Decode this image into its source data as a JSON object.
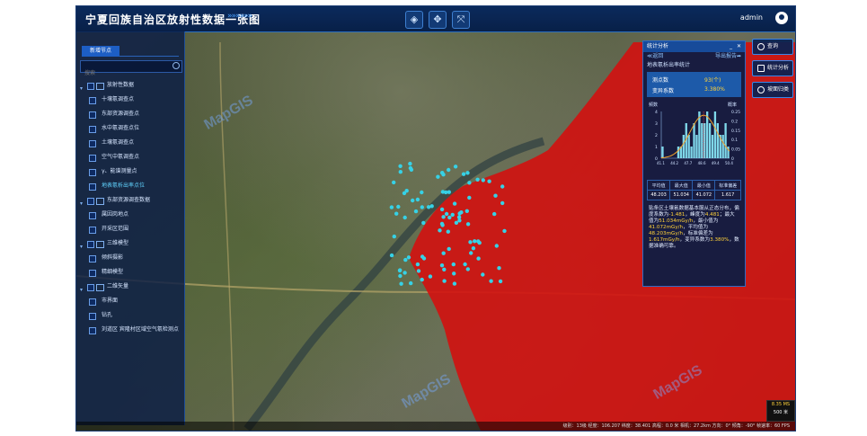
{
  "header": {
    "title": "宁夏回族自治区放射性数据一张图",
    "decor_arrows": "»»»»»»",
    "tools": [
      {
        "name": "layers-icon",
        "glyph": "◈"
      },
      {
        "name": "pan-icon",
        "glyph": "✥"
      },
      {
        "name": "fullscreen-icon",
        "glyph": "⤧"
      }
    ],
    "user": "admin"
  },
  "sidebar": {
    "tab_label": "新增节点",
    "search_placeholder": "搜索",
    "items": [
      {
        "label": "放射性数据",
        "level": 0,
        "type": "folder"
      },
      {
        "label": "十壤氡调查点",
        "level": 1
      },
      {
        "label": "东部资源调查点",
        "level": 1
      },
      {
        "label": "水中氡调查点位",
        "level": 1
      },
      {
        "label": "土壤氡调查点",
        "level": 1
      },
      {
        "label": "空气中氡调查点",
        "level": 1
      },
      {
        "label": "γ、能谱测量点",
        "level": 1
      },
      {
        "label": "地表氡析出率点位",
        "level": 1,
        "selected": true
      },
      {
        "label": "东部资源调查数据",
        "level": 0,
        "type": "folder"
      },
      {
        "label": "属因岗地点",
        "level": 1
      },
      {
        "label": "开采区范围",
        "level": 1
      },
      {
        "label": "三维模型",
        "level": 0,
        "type": "folder"
      },
      {
        "label": "倾斜摄影",
        "level": 1
      },
      {
        "label": "精细模型",
        "level": 1
      },
      {
        "label": "二维矢量",
        "level": 0,
        "type": "folder"
      },
      {
        "label": "市界面",
        "level": 1
      },
      {
        "label": "钻孔",
        "level": 1
      },
      {
        "label": "刘道区 宾隆村区域空气氡检测点",
        "level": 1
      }
    ]
  },
  "stats_panel": {
    "title": "统计分析",
    "minimize": "_",
    "close": "✕",
    "back": "≪返回",
    "export": "导出报告➦",
    "caption": "地表氡析出率统计",
    "summary": [
      {
        "label": "测点数",
        "value": "93(个)"
      },
      {
        "label": "变异系数",
        "value": "3.380%"
      }
    ],
    "table_headers": [
      "平均值",
      "最大值",
      "最小值",
      "标准偏差"
    ],
    "table_values": [
      "48.203",
      "51.034",
      "41.072",
      "1.617"
    ],
    "paragraph": [
      {
        "t": "    贴条区土壤氡数据基本服从正态分布，偏度系数为",
        "y": false
      },
      {
        "t": "-1.481",
        "y": true
      },
      {
        "t": "，峰度为",
        "y": false
      },
      {
        "t": "4.481",
        "y": true
      },
      {
        "t": "；最大值为",
        "y": false
      },
      {
        "t": "51.034mGy/h",
        "y": true
      },
      {
        "t": "，最小值为",
        "y": false
      },
      {
        "t": "41.072mGy/h",
        "y": true
      },
      {
        "t": "，平均值为",
        "y": false
      },
      {
        "t": "48.203mGy/h",
        "y": true
      },
      {
        "t": "，标准偏差为",
        "y": false
      },
      {
        "t": "1.617mGy/h",
        "y": true
      },
      {
        "t": "，变异系数为",
        "y": false
      },
      {
        "t": "3.380%",
        "y": true
      },
      {
        "t": "，数据准确可靠。",
        "y": false
      }
    ]
  },
  "chart_data": {
    "type": "bar",
    "title": "",
    "ylabel_left": "频数",
    "ylabel_right": "概率",
    "x_ticks": [
      "41.1",
      "44.2",
      "47.7",
      "48.6",
      "49.4",
      "50.4"
    ],
    "y_ticks_left": [
      "4",
      "3",
      "2",
      "1",
      "0"
    ],
    "y_ticks_right": [
      "0.25",
      "0.2",
      "0.15",
      "0.1",
      "0.05",
      "0"
    ],
    "ylim": [
      0,
      4
    ],
    "values": [
      1,
      0,
      0,
      0,
      0,
      0,
      1,
      1,
      2,
      3,
      2,
      1,
      3,
      2,
      4,
      3,
      3,
      4,
      3,
      2,
      4,
      3,
      2,
      2,
      3,
      1
    ],
    "curve": "normal-fit",
    "colors": {
      "bar": "#7fd8ea",
      "curve": "#f2a22b",
      "mean_line": "#ff3b3b"
    }
  },
  "right_buttons": [
    {
      "label": "查询",
      "icon": "search-icon"
    },
    {
      "label": "统计分析",
      "icon": "stats-icon"
    },
    {
      "label": "坡面归类",
      "icon": "classify-icon"
    }
  ],
  "scale": {
    "top": "8.35 MS",
    "bottom": "500 米"
  },
  "status_bar": "级别：13级 经度：106.207 纬度：38.401 高程：0.0 米 相机：27.2km 方向：0° 倾角：-90° 帧速率：60 FPS",
  "watermark": "MapGIS",
  "colors": {
    "accent": "#1d5ec4",
    "red_zone": "#d3110f",
    "points": "#36d1e6",
    "highlight": "#ffd23a"
  }
}
